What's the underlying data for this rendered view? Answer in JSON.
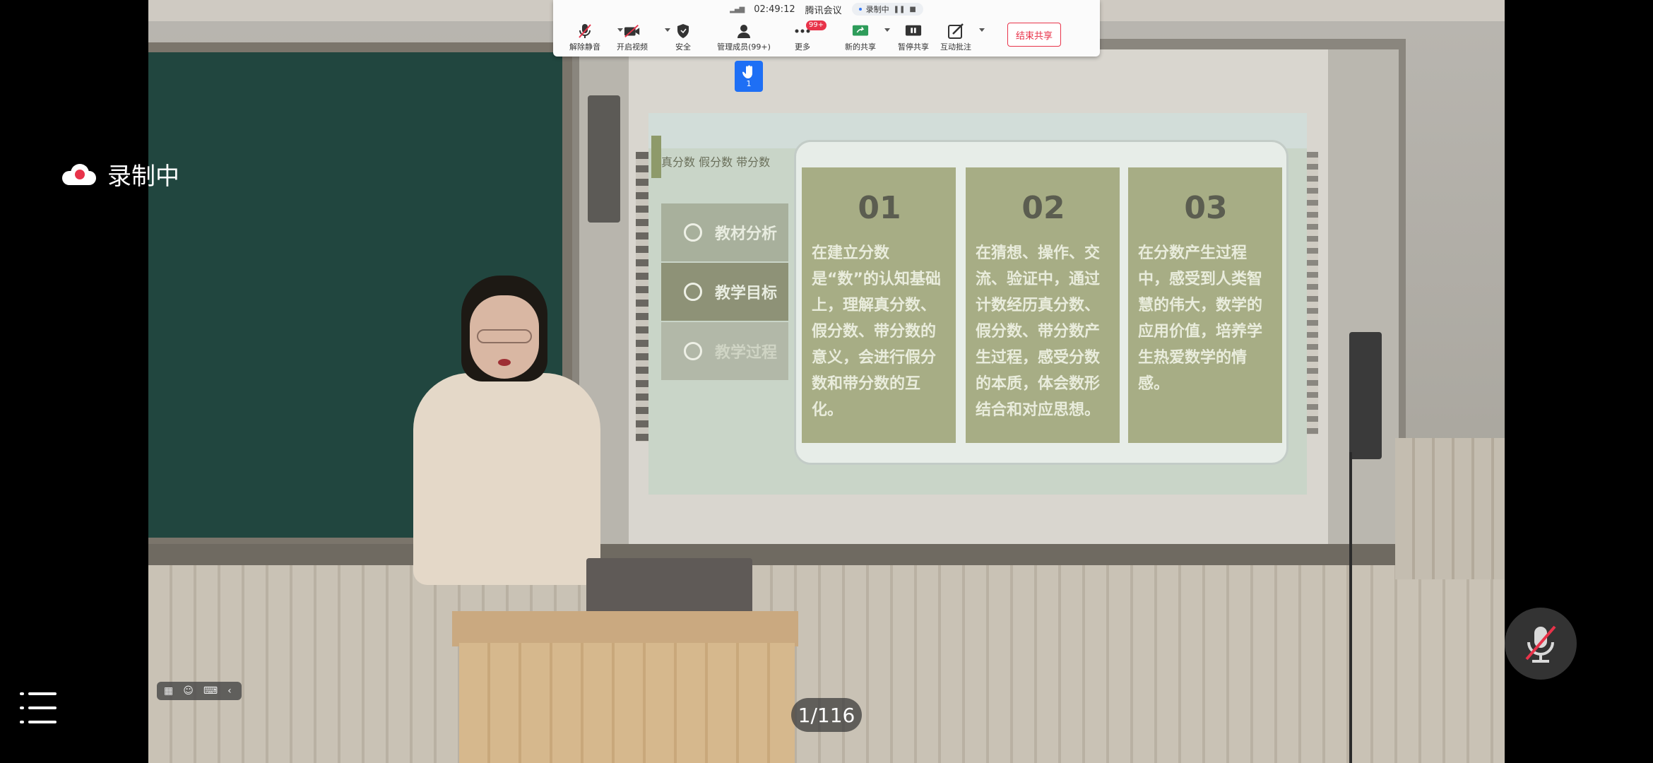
{
  "meeting_bar": {
    "time": "02:49:12",
    "app_name": "腾讯会议",
    "recording_chip": "录制中",
    "tools": {
      "unmute": "解除静音",
      "start_video": "开启视频",
      "security": "安全",
      "manage_members": "管理成员(99+)",
      "more": "更多",
      "more_badge": "99+",
      "new_share": "新的共享",
      "pause_share": "暂停共享",
      "annotate": "互动批注"
    },
    "end_share": "结束共享"
  },
  "hand_raise": {
    "count": "1"
  },
  "recording_indicator": {
    "label": "录制中"
  },
  "slide": {
    "heading": "真分数 假分数 带分数",
    "menu": [
      {
        "label": "教材分析"
      },
      {
        "label": "教学目标"
      },
      {
        "label": "教学过程"
      }
    ],
    "cards": [
      {
        "num": "01",
        "text": "在建立分数是“数”的认知基础上，理解真分数、假分数、带分数的意义，会进行假分数和带分数的互化。"
      },
      {
        "num": "02",
        "text": "在猜想、操作、交流、验证中，通过计数经历真分数、假分数、带分数产生过程，感受分数的本质，体会数形结合和对应思想。"
      },
      {
        "num": "03",
        "text": "在分数产生过程中，感受到人类智慧的伟大，数学的应用价值，培养学生热爱数学的情感。"
      }
    ]
  },
  "page_counter": "1/116",
  "colors": {
    "accent_red": "#e8334a",
    "hand_blue": "#1e6ff5",
    "card_green": "#a7ad85"
  }
}
